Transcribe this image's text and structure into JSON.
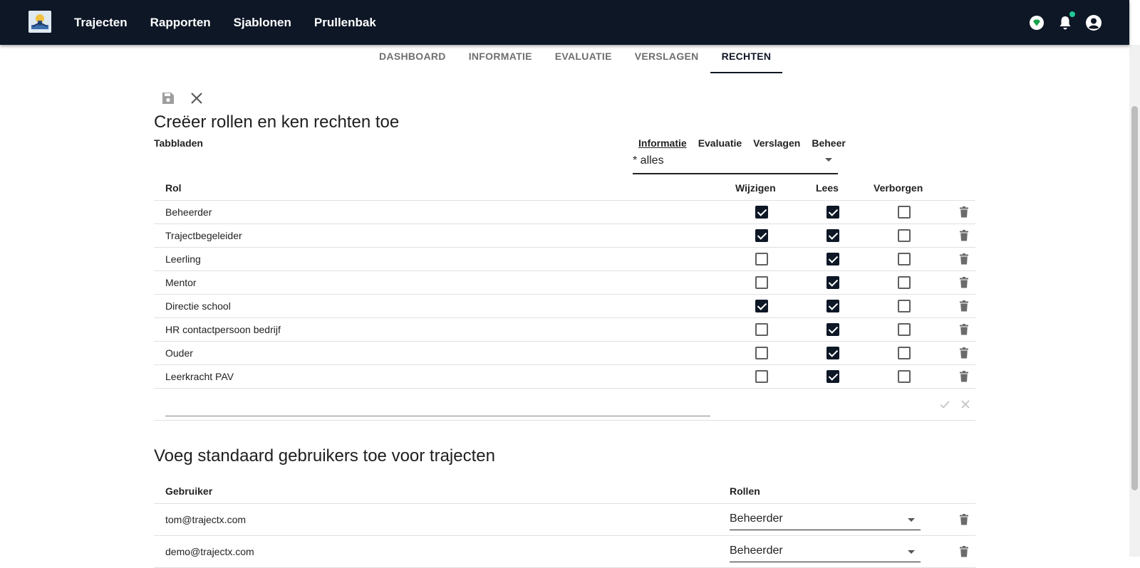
{
  "appbar": {
    "nav": [
      "Trajecten",
      "Rapporten",
      "Sjablonen",
      "Prullenbak"
    ],
    "icons": [
      "app-logo",
      "diamond-icon",
      "bell-icon",
      "account-icon"
    ],
    "accent": "#20c997",
    "background": "#0d1726"
  },
  "subtabs": [
    "DASHBOARD",
    "INFORMATIE",
    "EVALUATIE",
    "VERSLAGEN",
    "RECHTEN"
  ],
  "subtabs_active": "RECHTEN",
  "toolbar": {
    "icons": [
      "save-icon",
      "close-icon"
    ]
  },
  "roles_section": {
    "title": "Creëer rollen en ken rechten toe",
    "tabbladen_label": "Tabbladen",
    "right_tabs": [
      "Informatie",
      "Evaluatie",
      "Verslagen",
      "Beheer"
    ],
    "right_tabs_active": "Informatie",
    "filter_value": "* alles",
    "columns": {
      "rol": "Rol",
      "wijzigen": "Wijzigen",
      "lees": "Lees",
      "verborgen": "Verborgen"
    },
    "rows": [
      {
        "name": "Beheerder",
        "wijzigen": true,
        "lees": true,
        "verborgen": false
      },
      {
        "name": "Trajectbegeleider",
        "wijzigen": true,
        "lees": true,
        "verborgen": false
      },
      {
        "name": "Leerling",
        "wijzigen": false,
        "lees": true,
        "verborgen": false
      },
      {
        "name": "Mentor",
        "wijzigen": false,
        "lees": true,
        "verborgen": false
      },
      {
        "name": "Directie school",
        "wijzigen": true,
        "lees": true,
        "verborgen": false
      },
      {
        "name": "HR contactpersoon bedrijf",
        "wijzigen": false,
        "lees": true,
        "verborgen": false
      },
      {
        "name": "Ouder",
        "wijzigen": false,
        "lees": true,
        "verborgen": false
      },
      {
        "name": "Leerkracht PAV",
        "wijzigen": false,
        "lees": true,
        "verborgen": false
      }
    ],
    "new_role_value": ""
  },
  "users_section": {
    "title": "Voeg standaard gebruikers toe voor trajecten",
    "columns": {
      "gebruiker": "Gebruiker",
      "rollen": "Rollen"
    },
    "rows": [
      {
        "email": "tom@trajectx.com",
        "role": "Beheerder"
      },
      {
        "email": "demo@trajectx.com",
        "role": "Beheerder"
      }
    ]
  }
}
